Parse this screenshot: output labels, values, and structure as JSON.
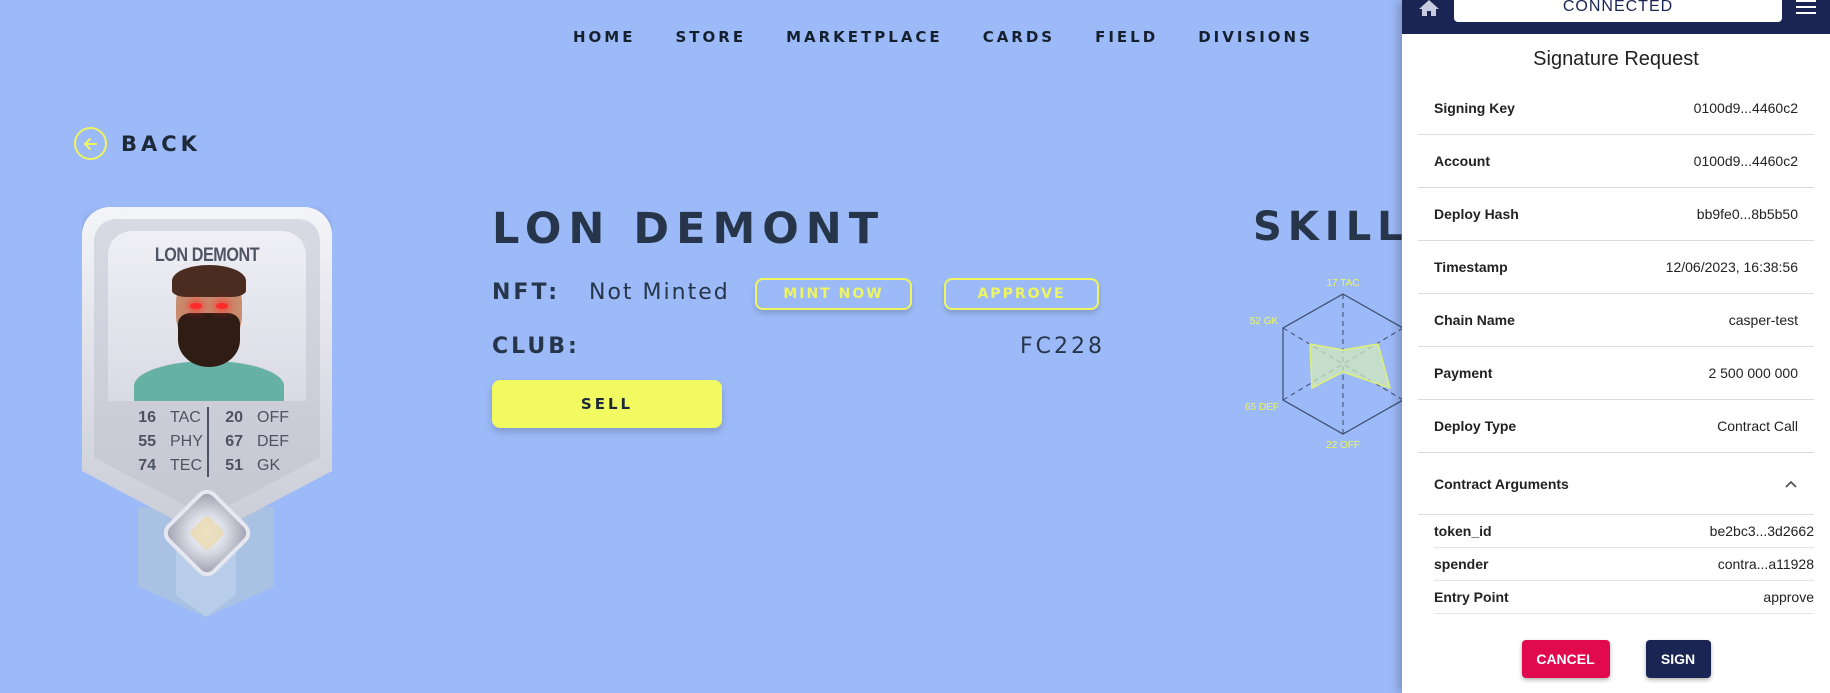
{
  "nav": [
    "HOME",
    "STORE",
    "MARKETPLACE",
    "CARDS",
    "FIELD",
    "DIVISIONS"
  ],
  "back_label": "BACK",
  "card": {
    "name": "LON DEMONT",
    "stats_left": [
      {
        "value": "16",
        "label": "TAC"
      },
      {
        "value": "55",
        "label": "PHY"
      },
      {
        "value": "74",
        "label": "TEC"
      }
    ],
    "stats_right": [
      {
        "value": "20",
        "label": "OFF"
      },
      {
        "value": "67",
        "label": "DEF"
      },
      {
        "value": "51",
        "label": "GK"
      }
    ]
  },
  "player": {
    "name": "LON DEMONT",
    "nft_label": "NFT:",
    "nft_value": "Not Minted",
    "mint_button": "MINT NOW",
    "approve_button": "APPROVE",
    "club_label": "CLUB:",
    "club_value": "FC228",
    "sell_button": "SELL"
  },
  "skills": {
    "title": "SKILLS",
    "labels": {
      "top": "17 TAC",
      "upper_left": "52 GK",
      "lower_left": "65 DEF",
      "bottom": "22 OFF"
    }
  },
  "panel": {
    "status": "CONNECTED",
    "title": "Signature Request",
    "rows": [
      {
        "key": "Signing Key",
        "value": "0100d9...4460c2"
      },
      {
        "key": "Account",
        "value": "0100d9...4460c2"
      },
      {
        "key": "Deploy Hash",
        "value": "bb9fe0...8b5b50"
      },
      {
        "key": "Timestamp",
        "value": "12/06/2023, 16:38:56"
      },
      {
        "key": "Chain Name",
        "value": "casper-test"
      },
      {
        "key": "Payment",
        "value": "2 500 000 000"
      },
      {
        "key": "Deploy Type",
        "value": "Contract Call"
      }
    ],
    "args_title": "Contract Arguments",
    "args": [
      {
        "key": "token_id",
        "value": "be2bc3...3d2662"
      },
      {
        "key": "spender",
        "value": "contra...a11928"
      },
      {
        "key": "Entry Point",
        "value": "approve"
      }
    ],
    "cancel_button": "CANCEL",
    "sign_button": "SIGN"
  },
  "colors": {
    "accent": "#eef55e",
    "background": "#9dbaf8",
    "panel_dark": "#1a2553",
    "cancel": "#e20a4f"
  }
}
